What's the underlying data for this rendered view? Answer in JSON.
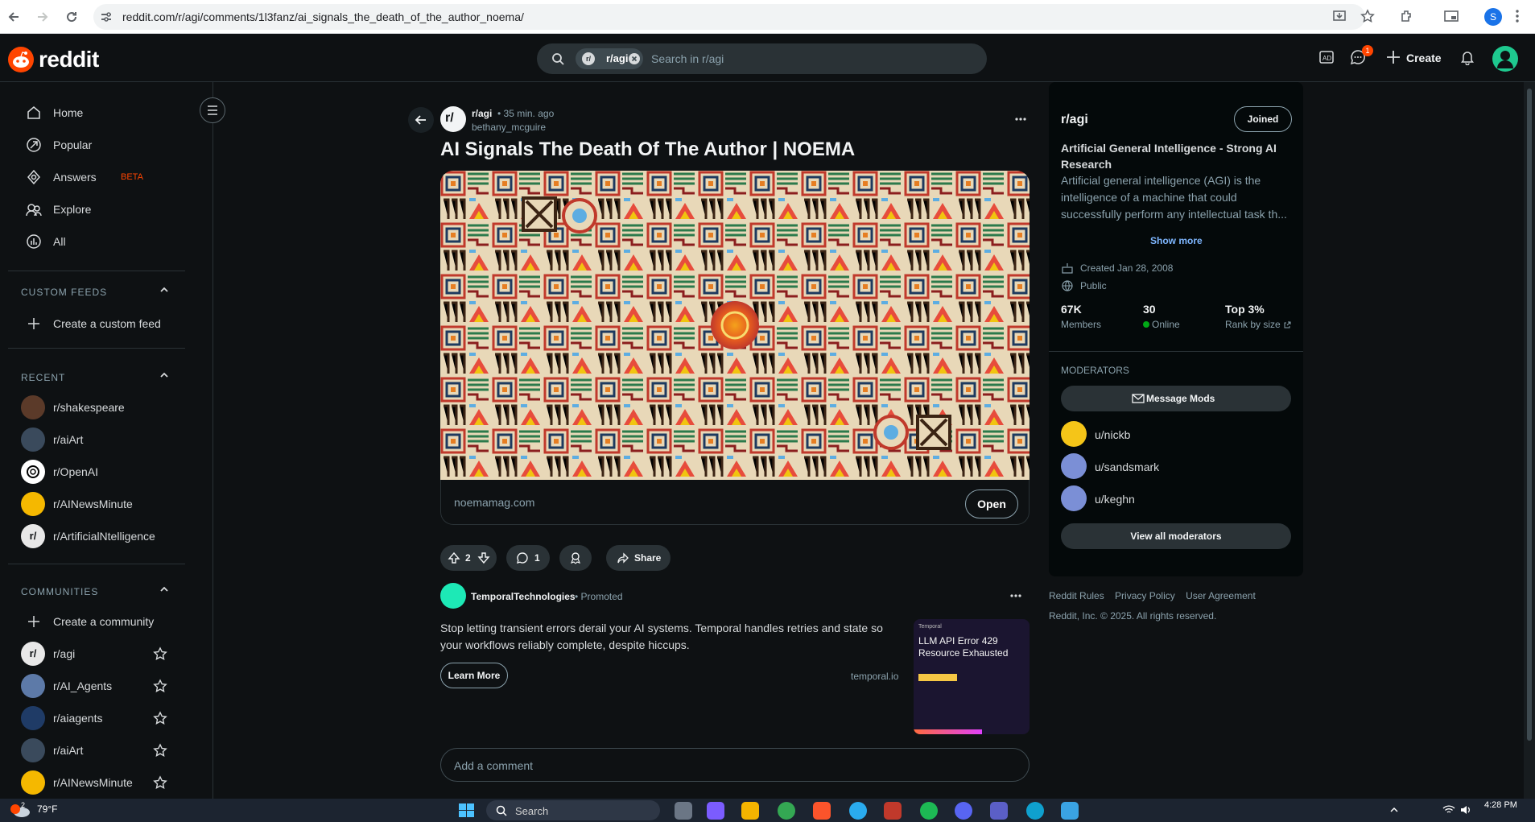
{
  "browser": {
    "url": "reddit.com/r/agi/comments/1l3fanz/ai_signals_the_death_of_the_author_noema/",
    "profile_initial": "S"
  },
  "header": {
    "logo_text": "reddit",
    "search_chip": "r/agi",
    "search_placeholder": "Search in r/agi",
    "create_label": "Create",
    "chat_badge": "1"
  },
  "sidebar": {
    "nav": [
      {
        "label": "Home",
        "icon": "home-icon"
      },
      {
        "label": "Popular",
        "icon": "popular-icon"
      },
      {
        "label": "Answers",
        "icon": "answers-icon",
        "badge": "BETA"
      },
      {
        "label": "Explore",
        "icon": "explore-icon"
      },
      {
        "label": "All",
        "icon": "all-icon"
      }
    ],
    "custom_feeds_heading": "CUSTOM FEEDS",
    "create_custom_feed": "Create a custom feed",
    "recent_heading": "RECENT",
    "recent": [
      {
        "label": "r/shakespeare",
        "color": "#5b3a29"
      },
      {
        "label": "r/aiArt",
        "color": "#3a4a5c"
      },
      {
        "label": "r/OpenAI",
        "color": "#ffffff"
      },
      {
        "label": "r/AINewsMinute",
        "color": "#f5b800"
      },
      {
        "label": "r/ArtificialNtelligence",
        "color": "#e8e8e8"
      }
    ],
    "communities_heading": "COMMUNITIES",
    "create_community": "Create a community",
    "communities": [
      {
        "label": "r/agi",
        "color": "#e8e8e8"
      },
      {
        "label": "r/AI_Agents",
        "color": "#5d7aa8"
      },
      {
        "label": "r/aiagents",
        "color": "#1f3b66"
      },
      {
        "label": "r/aiArt",
        "color": "#3a4a5c"
      },
      {
        "label": "r/AINewsMinute",
        "color": "#f5b800"
      }
    ]
  },
  "post": {
    "subreddit": "r/agi",
    "time": "• 35 min. ago",
    "author": "bethany_mcguire",
    "title": "AI Signals The Death Of The Author | NOEMA",
    "link_domain": "noemamag.com",
    "open_label": "Open",
    "votes": "2",
    "comments": "1",
    "share_label": "Share"
  },
  "promoted": {
    "name": "TemporalTechnologies",
    "tag": "• Promoted",
    "text": "Stop letting transient errors derail your AI systems. Temporal handles retries and state so your workflows reliably complete, despite hiccups.",
    "cta": "Learn More",
    "domain": "temporal.io",
    "image_title": "LLM API Error 429 Resource Exhausted",
    "image_brand": "Temporal"
  },
  "comment_placeholder": "Add a comment",
  "community_panel": {
    "name": "r/agi",
    "joined_label": "Joined",
    "headline": "Artificial General Intelligence - Strong AI Research",
    "description": "Artificial general intelligence (AGI) is the intelligence of a machine that could successfully perform any intellectual task th...",
    "show_more": "Show more",
    "created": "Created Jan 28, 2008",
    "visibility": "Public",
    "stats": [
      {
        "value": "67K",
        "label": "Members"
      },
      {
        "value": "30",
        "label": "Online"
      },
      {
        "value": "Top 3%",
        "label": "Rank by size"
      }
    ],
    "moderators_heading": "MODERATORS",
    "message_mods": "Message Mods",
    "moderators": [
      {
        "name": "u/nickb",
        "color": "#f5c518"
      },
      {
        "name": "u/sandsmark",
        "color": "#7b8fd6"
      },
      {
        "name": "u/keghn",
        "color": "#7b8fd6"
      }
    ],
    "view_all": "View all moderators"
  },
  "footer": {
    "links": [
      "Reddit Rules",
      "Privacy Policy",
      "User Agreement"
    ],
    "copyright": "Reddit, Inc. © 2025. All rights reserved."
  },
  "taskbar": {
    "weather_temp": "79°F",
    "weather_badge": "2",
    "search_label": "Search",
    "time": "4:28 PM"
  },
  "colors": {
    "brand": "#ff4500",
    "background": "#0e1113",
    "panel": "#04090a",
    "link": "#7eb6ff"
  }
}
